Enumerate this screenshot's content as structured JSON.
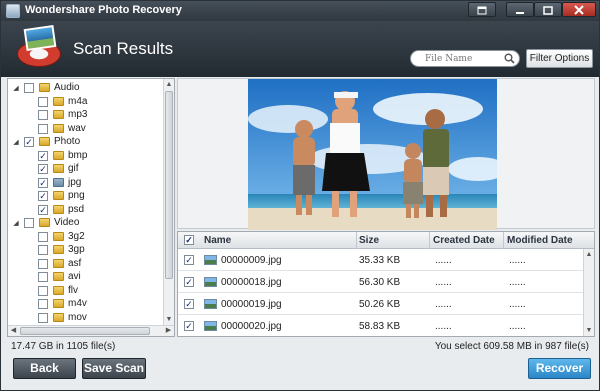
{
  "window": {
    "title": "Wondershare Photo Recovery"
  },
  "header": {
    "title": "Scan Results"
  },
  "search": {
    "placeholder": "File Name"
  },
  "toolbar": {
    "filter_label": "Filter Options"
  },
  "tree": [
    {
      "label": "Audio",
      "level": 0,
      "expanded": true,
      "checked": false
    },
    {
      "label": "m4a",
      "level": 1,
      "checked": false
    },
    {
      "label": "mp3",
      "level": 1,
      "checked": false
    },
    {
      "label": "wav",
      "level": 1,
      "checked": false
    },
    {
      "label": "Photo",
      "level": 0,
      "expanded": true,
      "checked": true
    },
    {
      "label": "bmp",
      "level": 1,
      "checked": true
    },
    {
      "label": "gif",
      "level": 1,
      "checked": true
    },
    {
      "label": "jpg",
      "level": 1,
      "checked": true,
      "selected": true
    },
    {
      "label": "png",
      "level": 1,
      "checked": true
    },
    {
      "label": "psd",
      "level": 1,
      "checked": true
    },
    {
      "label": "Video",
      "level": 0,
      "expanded": true,
      "checked": false
    },
    {
      "label": "3g2",
      "level": 1,
      "checked": false
    },
    {
      "label": "3gp",
      "level": 1,
      "checked": false
    },
    {
      "label": "asf",
      "level": 1,
      "checked": false
    },
    {
      "label": "avi",
      "level": 1,
      "checked": false
    },
    {
      "label": "flv",
      "level": 1,
      "checked": false
    },
    {
      "label": "m4v",
      "level": 1,
      "checked": false
    },
    {
      "label": "mov",
      "level": 1,
      "checked": false
    }
  ],
  "table": {
    "columns": [
      "Name",
      "Size",
      "Created Date",
      "Modified Date"
    ],
    "rows": [
      {
        "name": "00000009.jpg",
        "size": "35.33 KB",
        "created": "......",
        "modified": "......",
        "checked": true
      },
      {
        "name": "00000018.jpg",
        "size": "56.30 KB",
        "created": "......",
        "modified": "......",
        "checked": true
      },
      {
        "name": "00000019.jpg",
        "size": "50.26 KB",
        "created": "......",
        "modified": "......",
        "checked": true
      },
      {
        "name": "00000020.jpg",
        "size": "58.83 KB",
        "created": "......",
        "modified": "......",
        "checked": true
      }
    ]
  },
  "status": {
    "left": "17.47 GB in 1105 file(s)",
    "right": "You select 609.58 MB in 987 file(s)"
  },
  "buttons": {
    "back": "Back",
    "save_scan": "Save Scan",
    "recover": "Recover"
  },
  "colors": {
    "accent": "#2b86c7",
    "header_bg": "#2f373f"
  }
}
